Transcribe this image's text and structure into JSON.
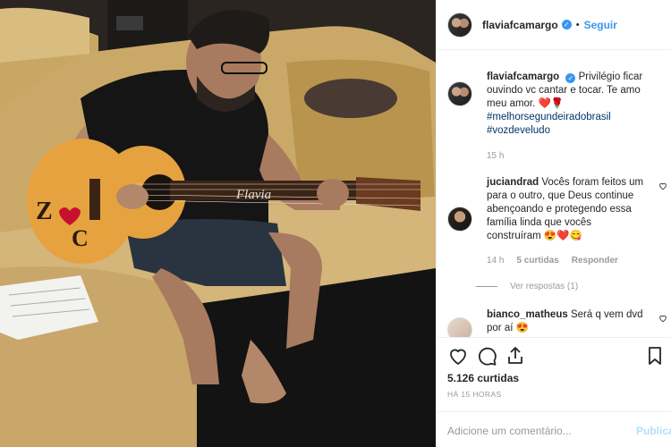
{
  "post": {
    "author": "flaviafcamargo",
    "follow_label": "Seguir",
    "verified_mark": "✓",
    "caption": "Privilégio ficar ouvindo vc cantar e tocar. Te amo meu amor.",
    "caption_emojis": "❤️🌹",
    "hashtags": [
      "#melhorsegundeiradobrasil",
      "#vozdeveludo"
    ],
    "caption_age": "15 h",
    "guitar_inscription": "Flavia"
  },
  "comments": [
    {
      "username": "juciandrad",
      "text": "Vocês foram feitos um para o outro, que Deus continue abençoando e protegendo essa família linda que vocês construíram",
      "emojis": "😍❤️😋",
      "age": "14 h",
      "likes": "5 curtidas",
      "reply_label": "Responder",
      "view_replies": "Ver respostas (1)"
    },
    {
      "username": "bianco_matheus",
      "text": "Será q vem dvd por aí",
      "emojis": "😍"
    }
  ],
  "stats": {
    "likes": "5.126 curtidas",
    "timestamp": "HÁ 15 HORAS"
  },
  "composer": {
    "placeholder": "Adicione um comentário...",
    "publish_label": "Publicar"
  },
  "icons": {
    "like": "heart-icon",
    "comment": "comment-icon",
    "share": "share-icon",
    "save": "bookmark-icon"
  },
  "colors": {
    "link": "#3897f0",
    "hashtag": "#003569",
    "muted": "#999999",
    "heart": "#ed1c24"
  }
}
